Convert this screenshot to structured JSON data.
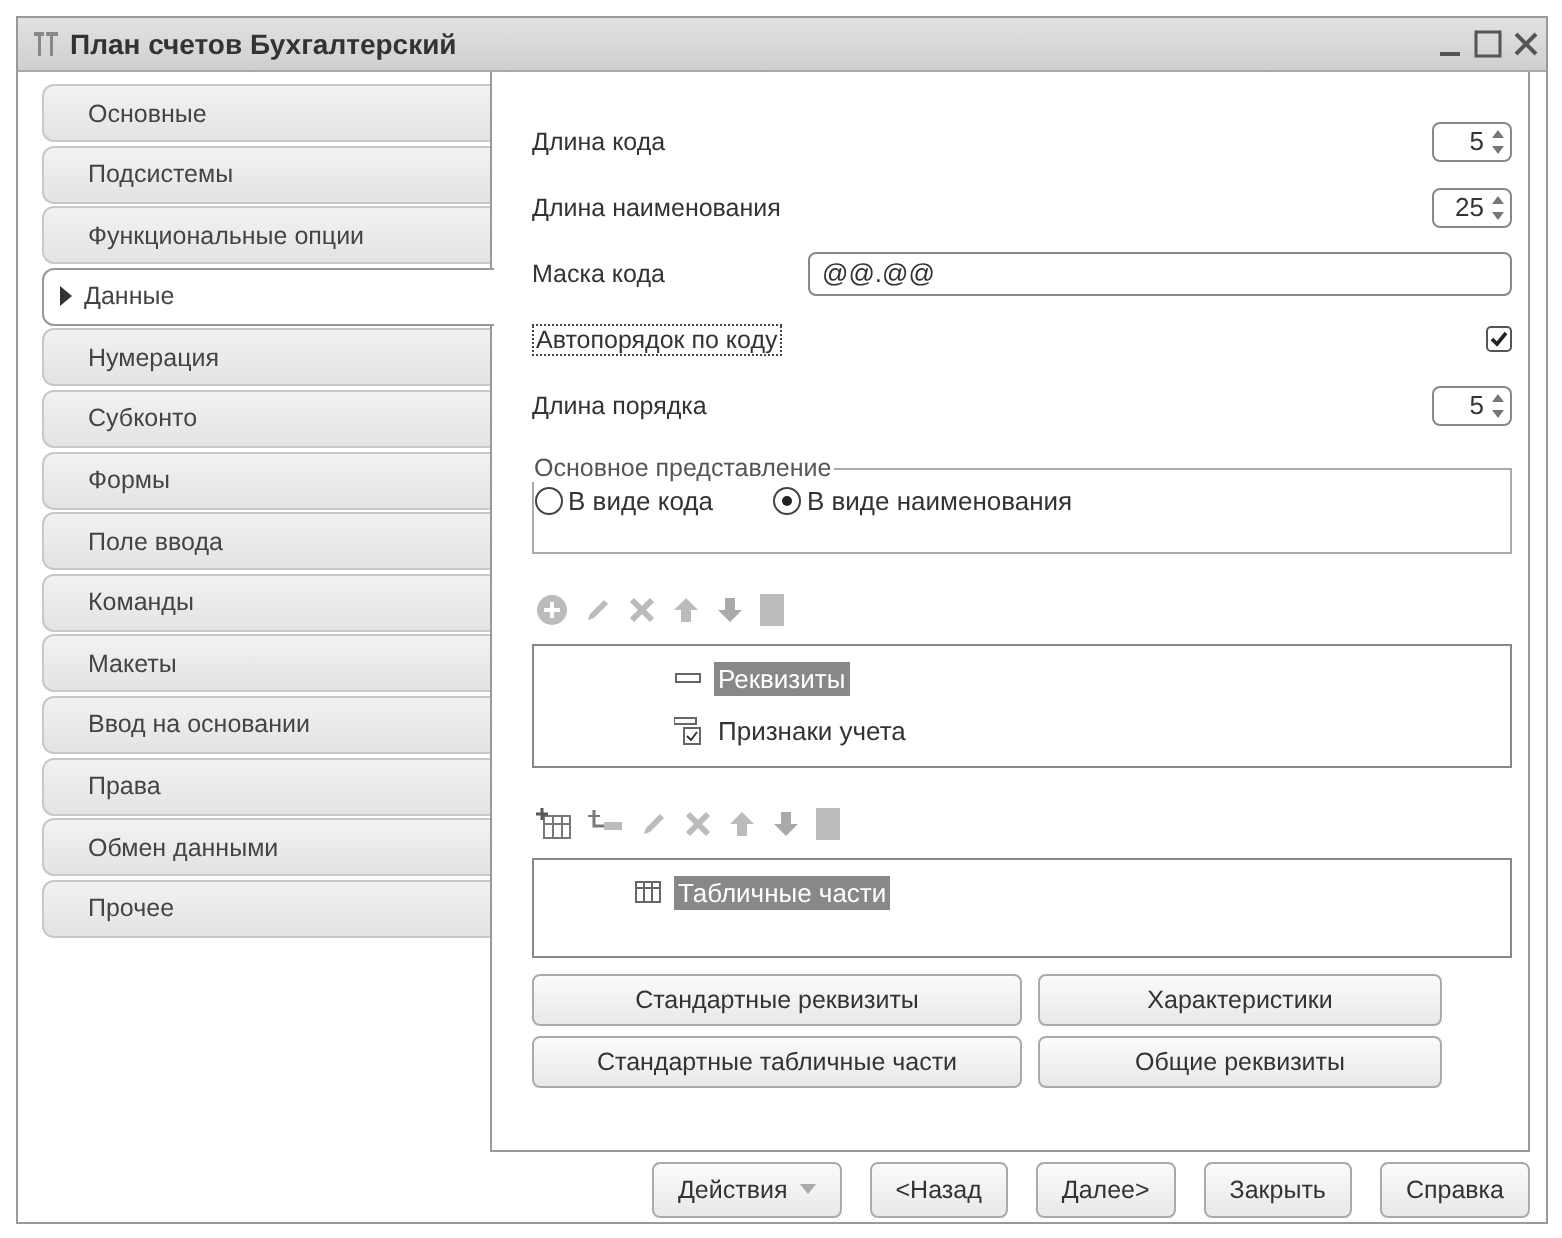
{
  "window": {
    "title": "План счетов Бухгалтерский"
  },
  "tabs": [
    {
      "label": "Основные",
      "selected": false
    },
    {
      "label": "Подсистемы",
      "selected": false
    },
    {
      "label": "Функциональные опции",
      "selected": false
    },
    {
      "label": "Данные",
      "selected": true
    },
    {
      "label": "Нумерация",
      "selected": false
    },
    {
      "label": "Субконто",
      "selected": false
    },
    {
      "label": "Формы",
      "selected": false
    },
    {
      "label": "Поле ввода",
      "selected": false
    },
    {
      "label": "Команды",
      "selected": false
    },
    {
      "label": "Макеты",
      "selected": false
    },
    {
      "label": "Ввод на основании",
      "selected": false
    },
    {
      "label": "Права",
      "selected": false
    },
    {
      "label": "Обмен данными",
      "selected": false
    },
    {
      "label": "Прочее",
      "selected": false
    }
  ],
  "fields": [
    {
      "kind": "spin",
      "label": "Длина кода",
      "value": "5"
    },
    {
      "kind": "spin",
      "label": "Длина наименования",
      "value": "25"
    },
    {
      "kind": "text",
      "label": "Маска кода",
      "value": "@@.@@"
    },
    {
      "kind": "check",
      "label": "Автопорядок по коду",
      "checked": true
    },
    {
      "kind": "spin",
      "label": "Длина порядка",
      "value": "5"
    }
  ],
  "presentation": {
    "title": "Основное представление",
    "options": [
      {
        "label": "В виде кода",
        "selected": false
      },
      {
        "label": "В виде наименования",
        "selected": true
      }
    ]
  },
  "attributes_list": {
    "items": [
      {
        "kind": "attribute",
        "label": "Реквизиты",
        "selected": true
      },
      {
        "kind": "flags",
        "label": "Признаки учета",
        "selected": false
      }
    ]
  },
  "tables_list": {
    "items": [
      {
        "kind": "table",
        "label": "Табличные части",
        "selected": true
      }
    ]
  },
  "panel_buttons": [
    "Стандартные реквизиты",
    "Характеристики",
    "Стандартные табличные части",
    "Общие реквизиты"
  ],
  "footer_buttons": [
    {
      "kind": "menu",
      "label": "Действия"
    },
    {
      "kind": "plain",
      "label": "<Назад"
    },
    {
      "kind": "plain",
      "label": "Далее>"
    },
    {
      "kind": "plain",
      "label": "Закрыть"
    },
    {
      "kind": "plain",
      "label": "Справка"
    }
  ]
}
